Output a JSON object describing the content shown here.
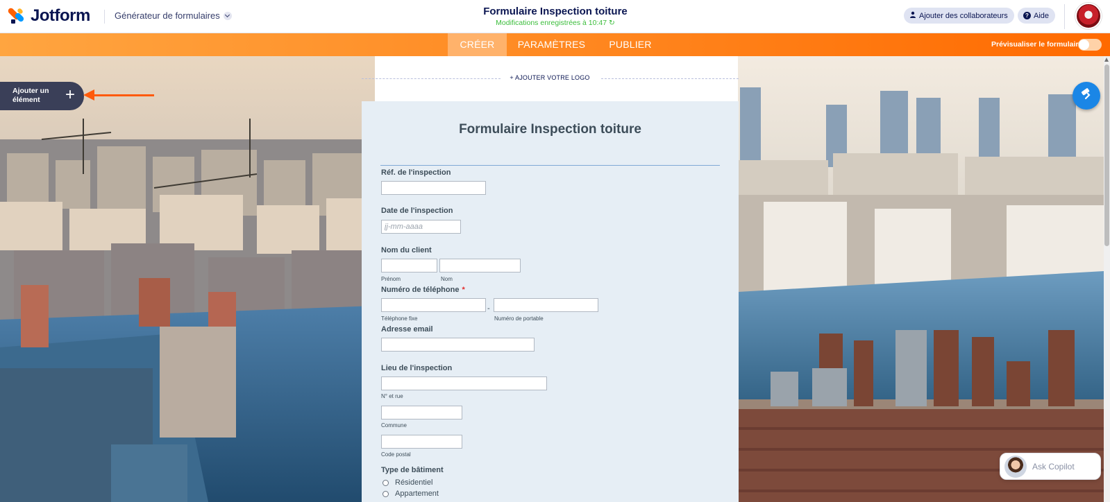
{
  "header": {
    "brand": "Jotform",
    "builder_menu": "Générateur de formulaires",
    "form_title": "Formulaire Inspection toiture",
    "save_status": "Modifications enregistrées à 10:47",
    "collaborators_button": "Ajouter des collaborateurs",
    "help_button": "Aide"
  },
  "nav": {
    "tabs": [
      {
        "label": "CRÉER",
        "active": true
      },
      {
        "label": "PARAMÈTRES",
        "active": false
      },
      {
        "label": "PUBLIER",
        "active": false
      }
    ],
    "preview_label": "Prévisualiser le formulaire",
    "preview_enabled": false
  },
  "canvas": {
    "add_logo": "+ AJOUTER VOTRE LOGO",
    "add_element": "Ajouter un élément"
  },
  "form": {
    "heading": "Formulaire Inspection toiture",
    "fields": {
      "ref_label": "Réf. de l'inspection",
      "date_label": "Date de l'inspection",
      "date_placeholder": "jj-mm-aaaa",
      "client_label": "Nom du client",
      "first_name_sub": "Prénom",
      "last_name_sub": "Nom",
      "phone_label": "Numéro de téléphone",
      "phone_required": "*",
      "phone_separator": "-",
      "phone_fixed_sub": "Téléphone fixe",
      "phone_mobile_sub": "Numéro de portable",
      "email_label": "Adresse email",
      "location_label": "Lieu de l'inspection",
      "street_sub": "N° et rue",
      "city_sub": "Commune",
      "zip_sub": "Code postal",
      "building_label": "Type de bâtiment",
      "building_options": [
        "Résidentiel",
        "Appartement"
      ]
    }
  },
  "copilot": {
    "label": "Ask Copilot"
  },
  "colors": {
    "brand_orange": "#ff6100",
    "brand_blue": "#0099ff",
    "navy": "#0a1551",
    "save_green": "#3bbd3b",
    "designer_blue": "#1a86e6"
  },
  "icons": [
    "chevron-down-icon",
    "refresh-icon",
    "user-icon",
    "help-icon",
    "plus-icon",
    "paint-roller-icon"
  ]
}
